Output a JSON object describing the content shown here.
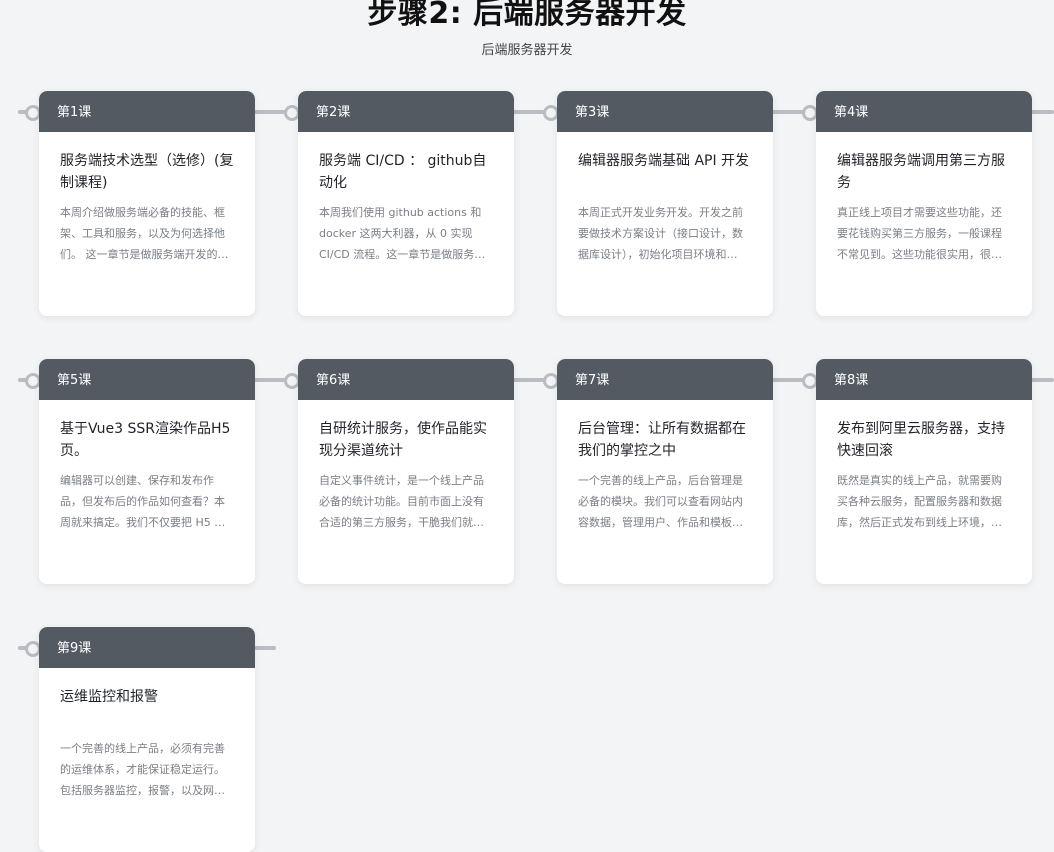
{
  "header": {
    "title": "步骤2: 后端服务器开发",
    "subtitle": "后端服务器开发"
  },
  "lessons": [
    {
      "label": "第1课",
      "title": "服务端技术选型（选修）(复制课程)",
      "desc": "本周介绍做服务端必备的技能、框架、工具和服务，以及为何选择他们。 这一章节是做服务端开发的基础，十分重要。"
    },
    {
      "label": "第2课",
      "title": "服务端 CI/CD ： github自动化",
      "desc": "本周我们使用 github actions 和 docker 这两大利器，从 0 实现 CI/CD 流程。这一章节是做服务端开发的核心。"
    },
    {
      "label": "第3课",
      "title": "编辑器服务端基础 API 开发",
      "desc": "本周正式开发业务开发。开发之前要做技术方案设计（接口设计，数据库设计），初始化项目环境和 CI/CD 流程。"
    },
    {
      "label": "第4课",
      "title": "编辑器服务端调用第三方服务",
      "desc": "真正线上项目才需要这些功能，还要花钱购买第三方服务，一般课程不常见到。这些功能很实用，很大众，非常值得学习。"
    },
    {
      "label": "第5课",
      "title": "基于Vue3 SSR渲染作品H5页。",
      "desc": "编辑器可以创建、保存和发布作品，但发布后的作品如何查看？本周就来搞定。我们不仅要把 H5 页渲染出来，还要保证性能。"
    },
    {
      "label": "第6课",
      "title": "自研统计服务，使作品能实现分渠道统计",
      "desc": "自定义事件统计，是一个线上产品必备的统计功能。目前市面上没有合适的第三方服务，干脆我们就自研一套统计服务。"
    },
    {
      "label": "第7课",
      "title": "后台管理：让所有数据都在我们的掌控之中",
      "desc": "一个完善的线上产品，后台管理是必备的模块。我们可以查看网站内容数据，管理用户、作品和模板，推荐优质作品等。"
    },
    {
      "label": "第8课",
      "title": "发布到阿里云服务器，支持快速回滚",
      "desc": "既然是真实的线上产品，就需要购买各种云服务，配置服务器和数据库，然后正式发布到线上环境，一旦遇到问题要快速回滚。"
    },
    {
      "label": "第9课",
      "title": "运维监控和报警",
      "desc": "一个完善的线上产品，必须有完善的运维体系，才能保证稳定运行。包括服务器监控，报警，以及网络安全等多个方面。"
    }
  ]
}
